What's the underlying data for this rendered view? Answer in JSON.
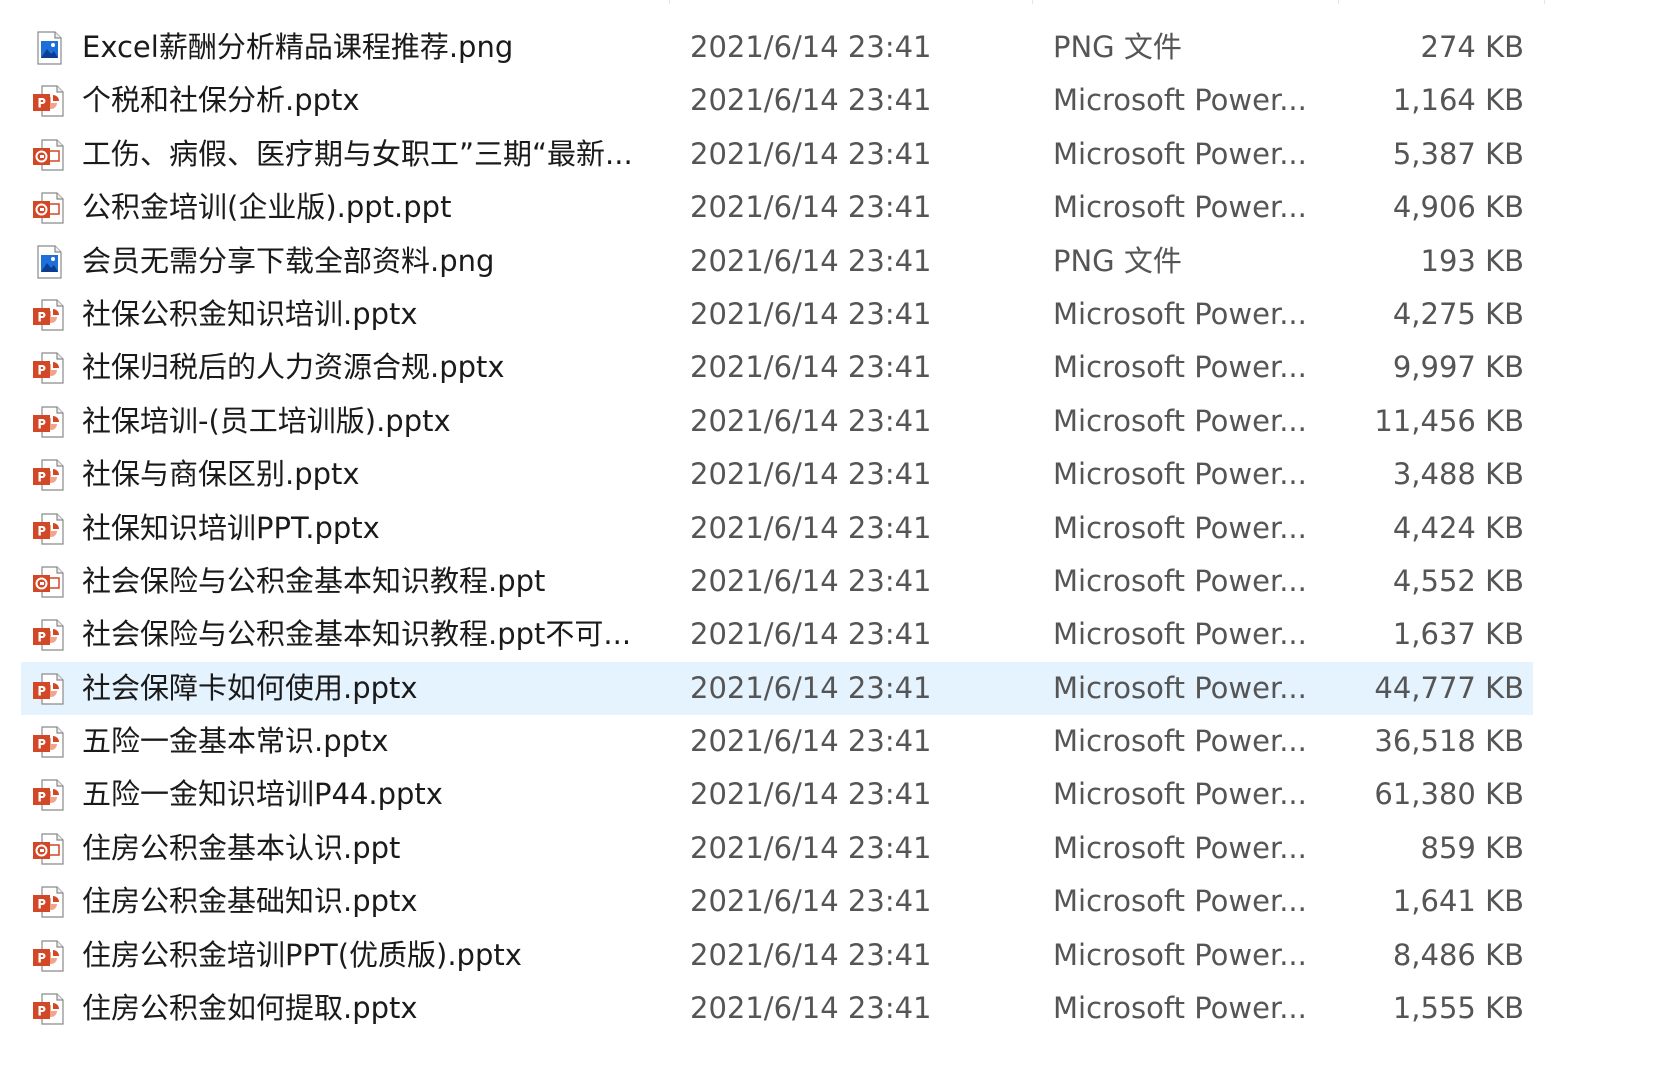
{
  "colors": {
    "selected_row_bg": "#e5f3ff",
    "ppt_red": "#d24726",
    "png_blue": "#1e6fd9"
  },
  "files": [
    {
      "name": "Excel薪酬分析精品课程推荐.png",
      "date": "2021/6/14 23:41",
      "type": "PNG 文件",
      "size": "274 KB",
      "icon": "png-image-icon"
    },
    {
      "name": "个税和社保分析.pptx",
      "date": "2021/6/14 23:41",
      "type": "Microsoft Power...",
      "size": "1,164 KB",
      "icon": "pptx-file-icon"
    },
    {
      "name": "工伤、病假、医疗期与女职工”三期“最新...",
      "date": "2021/6/14 23:41",
      "type": "Microsoft Power...",
      "size": "5,387 KB",
      "icon": "ppt-file-icon"
    },
    {
      "name": "公积金培训(企业版).ppt.ppt",
      "date": "2021/6/14 23:41",
      "type": "Microsoft Power...",
      "size": "4,906 KB",
      "icon": "ppt-file-icon"
    },
    {
      "name": "会员无需分享下载全部资料.png",
      "date": "2021/6/14 23:41",
      "type": "PNG 文件",
      "size": "193 KB",
      "icon": "png-image-icon"
    },
    {
      "name": "社保公积金知识培训.pptx",
      "date": "2021/6/14 23:41",
      "type": "Microsoft Power...",
      "size": "4,275 KB",
      "icon": "pptx-file-icon"
    },
    {
      "name": "社保归税后的人力资源合规.pptx",
      "date": "2021/6/14 23:41",
      "type": "Microsoft Power...",
      "size": "9,997 KB",
      "icon": "pptx-file-icon"
    },
    {
      "name": "社保培训-(员工培训版).pptx",
      "date": "2021/6/14 23:41",
      "type": "Microsoft Power...",
      "size": "11,456 KB",
      "icon": "pptx-file-icon"
    },
    {
      "name": "社保与商保区别.pptx",
      "date": "2021/6/14 23:41",
      "type": "Microsoft Power...",
      "size": "3,488 KB",
      "icon": "pptx-file-icon"
    },
    {
      "name": "社保知识培训PPT.pptx",
      "date": "2021/6/14 23:41",
      "type": "Microsoft Power...",
      "size": "4,424 KB",
      "icon": "pptx-file-icon"
    },
    {
      "name": "社会保险与公积金基本知识教程.ppt",
      "date": "2021/6/14 23:41",
      "type": "Microsoft Power...",
      "size": "4,552 KB",
      "icon": "ppt-file-icon"
    },
    {
      "name": "社会保险与公积金基本知识教程.ppt不可...",
      "date": "2021/6/14 23:41",
      "type": "Microsoft Power...",
      "size": "1,637 KB",
      "icon": "pptx-file-icon"
    },
    {
      "name": "社会保障卡如何使用.pptx",
      "date": "2021/6/14 23:41",
      "type": "Microsoft Power...",
      "size": "44,777 KB",
      "icon": "pptx-file-icon",
      "selected": true
    },
    {
      "name": "五险一金基本常识.pptx",
      "date": "2021/6/14 23:41",
      "type": "Microsoft Power...",
      "size": "36,518 KB",
      "icon": "pptx-file-icon"
    },
    {
      "name": "五险一金知识培训P44.pptx",
      "date": "2021/6/14 23:41",
      "type": "Microsoft Power...",
      "size": "61,380 KB",
      "icon": "pptx-file-icon"
    },
    {
      "name": "住房公积金基本认识.ppt",
      "date": "2021/6/14 23:41",
      "type": "Microsoft Power...",
      "size": "859 KB",
      "icon": "ppt-file-icon"
    },
    {
      "name": "住房公积金基础知识.pptx",
      "date": "2021/6/14 23:41",
      "type": "Microsoft Power...",
      "size": "1,641 KB",
      "icon": "pptx-file-icon"
    },
    {
      "name": "住房公积金培训PPT(优质版).pptx",
      "date": "2021/6/14 23:41",
      "type": "Microsoft Power...",
      "size": "8,486 KB",
      "icon": "pptx-file-icon"
    },
    {
      "name": "住房公积金如何提取.pptx",
      "date": "2021/6/14 23:41",
      "type": "Microsoft Power...",
      "size": "1,555 KB",
      "icon": "pptx-file-icon"
    }
  ]
}
